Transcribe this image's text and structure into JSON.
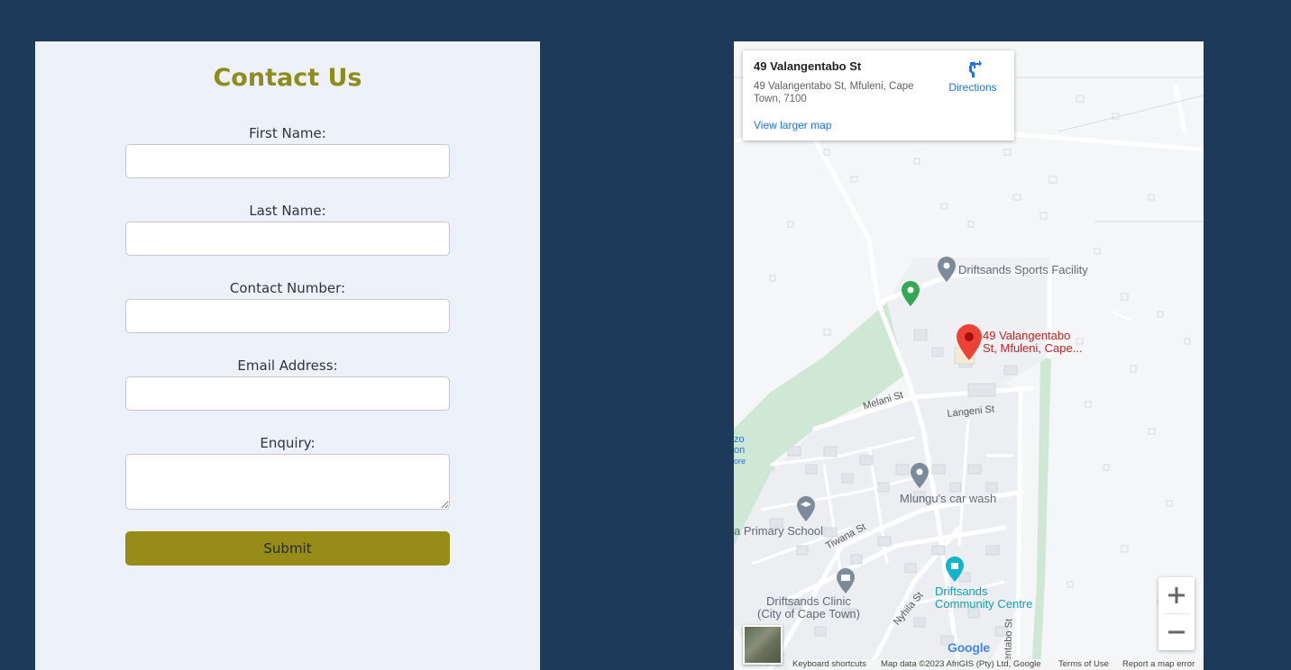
{
  "form": {
    "title": "Contact Us",
    "fields": [
      {
        "label": "First Name:",
        "value": ""
      },
      {
        "label": "Last Name:",
        "value": ""
      },
      {
        "label": "Contact Number:",
        "value": ""
      },
      {
        "label": "Email Address:",
        "value": ""
      },
      {
        "label": "Enquiry:",
        "value": ""
      }
    ],
    "submit_label": "Submit"
  },
  "colors": {
    "page_background": "#1d3a5a",
    "panel_background": "#edf2fa",
    "title_color": "#8f8c1e",
    "submit_background": "#988c18",
    "link_blue": "#1a73e8",
    "pin_red": "#ea4335"
  },
  "map": {
    "card": {
      "name": "49 Valangentabo St",
      "address": "49 Valangentabo St, Mfuleni, Cape Town, 7100",
      "larger_map_link": "View larger map",
      "directions_label": "Directions"
    },
    "places": {
      "sports_facility": "Driftsands Sports Facility",
      "pin_label_line1": "49 Valangentabo",
      "pin_label_line2": "St, Mfuleni, Cape...",
      "car_wash": "Mlungu's car wash",
      "primary_school": "a Primary School",
      "clinic_line1": "Driftsands Clinic",
      "clinic_line2": "(City of Cape Town)",
      "community_line1": "Driftsands",
      "community_line2": "Community Centre",
      "edge_partial_1": "zo",
      "edge_partial_2": "on",
      "edge_partial_3": "ore"
    },
    "streets": {
      "melani": "Melani St",
      "langeni": "Langeni St",
      "tiwana": "Tiwana St",
      "nyhila": "Nyhila St",
      "valangentabo": "entabo St"
    },
    "icons": {
      "directions": "directions-icon",
      "zoom_in": "plus-icon",
      "zoom_out": "minus-icon",
      "location_pin": "location-pin-icon",
      "school": "school-icon",
      "museum": "museum-icon",
      "community": "community-centre-icon"
    },
    "logo": "Google",
    "attribution": {
      "keyboard": "Keyboard shortcuts",
      "map_data": "Map data ©2023 AfriGIS (Pty) Ltd, Google",
      "terms": "Terms of Use",
      "report": "Report a map error"
    }
  }
}
